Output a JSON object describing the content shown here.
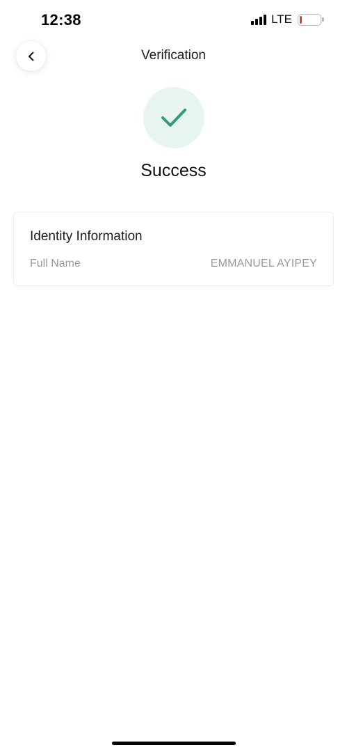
{
  "status_bar": {
    "time": "12:38",
    "network": "LTE",
    "signal_bars": 4,
    "battery_level": 0.12,
    "battery_color": "#e53935"
  },
  "header": {
    "back_icon": "chevron-left-icon",
    "title": "Verification"
  },
  "result": {
    "icon": "checkmark-icon",
    "icon_color": "#2e9e6e",
    "icon_bg_color": "#e8f4ef",
    "heading": "Success"
  },
  "identity_card": {
    "title": "Identity Information",
    "rows": [
      {
        "label": "Full Name",
        "value": "EMMANUEL AYIPEY"
      }
    ]
  }
}
